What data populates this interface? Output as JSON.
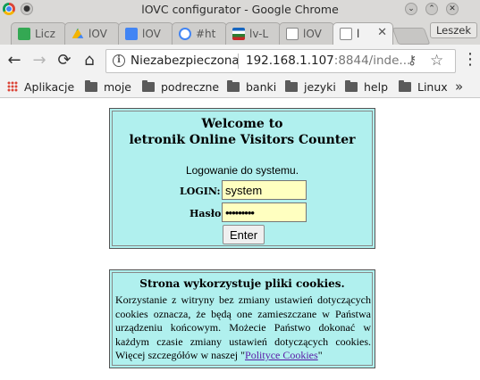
{
  "window": {
    "title": "lOVC configurator - Google Chrome",
    "minimize_glyph": "⌄",
    "close_glyph": "✕",
    "back_glyph": "⟨"
  },
  "tabs": [
    {
      "label": "Licz",
      "favicon_color": "#34a853"
    },
    {
      "label": "lOV",
      "favicon_color": "#1a73e8"
    },
    {
      "label": "lOV",
      "favicon_color": "#4285f4"
    },
    {
      "label": "#ht",
      "favicon_color": "#ea4335"
    },
    {
      "label": "lv-L",
      "favicon_color": "#0f9d58"
    },
    {
      "label": "lOV",
      "favicon_color": "#9e9e9e"
    },
    {
      "label": "l",
      "favicon_color": "#9e9e9e",
      "active": true
    }
  ],
  "profile": {
    "label": "Leszek"
  },
  "toolbar": {
    "back": "←",
    "forward": "→",
    "reload": "⟳",
    "home": "⌂"
  },
  "omnibox": {
    "security_label": "Niezabezpieczona",
    "url_host": "192.168.1.107",
    "url_rest": ":8844/inde..."
  },
  "bookmarks": {
    "apps_label": "Aplikacje",
    "items": [
      "moje",
      "podreczne",
      "banki",
      "jezyki",
      "help",
      "Linux"
    ],
    "more": "»"
  },
  "login": {
    "title_line1": "Welcome to",
    "title_line2": "letronik Online Visitors Counter",
    "heading": "Logowanie do systemu.",
    "login_label": "LOGIN:",
    "login_value": "system",
    "password_label": "Hasło:",
    "password_value": "•••••••••",
    "enter_label": "Enter"
  },
  "cookies": {
    "title": "Strona wykorzystuje pliki cookies.",
    "text": "Korzystanie z witryny bez zmiany ustawień dotyczących cookies oznacza, że będą one zamieszczane w Państwa urządzeniu końcowym. Możecie Państwo dokonać w każdym czasie zmiany ustawień dotyczących cookies. Więcej szczegółów w naszej \"",
    "link_label": "Polityce Cookies",
    "text_end": "\""
  }
}
